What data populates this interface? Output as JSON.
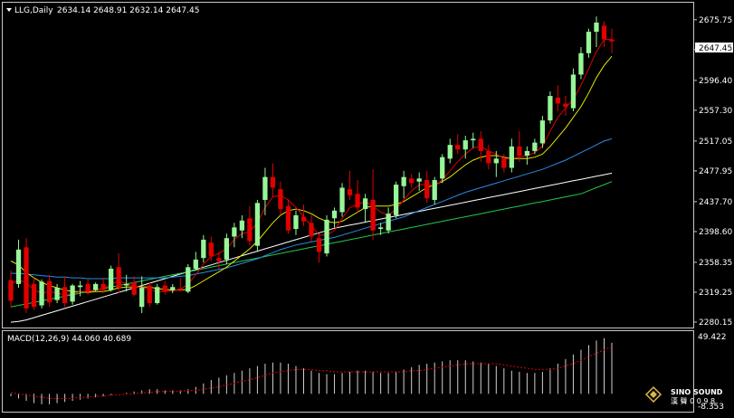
{
  "window": {
    "symbol_timeframe": "LLG,Daily",
    "ohlc_readout": "2634.14 2648.91 2632.14 2647.45",
    "menu_icon": "triangle-down-icon"
  },
  "colors": {
    "background": "#000000",
    "frame": "#c8c8c8",
    "grid_text": "#ffffff",
    "bull_candle": "#98f598",
    "bear_candle": "#e00000",
    "ma_fast": "#e00000",
    "ma_slow": "#e6e600",
    "ma_blue": "#2a8be6",
    "ma_green": "#22c84a",
    "ma_white": "#ffffff",
    "macd_hist": "#cfcfcf",
    "macd_signal": "#e00000",
    "price_tag_bg": "#ffffff",
    "price_tag_text": "#000000"
  },
  "price_axis": {
    "ticks": [
      "2675.75",
      "2636.65",
      "2596.40",
      "2557.30",
      "2517.05",
      "2477.95",
      "2437.70",
      "2398.60",
      "2358.35",
      "2319.25",
      "2280.15"
    ],
    "current_price_label": "2647.45"
  },
  "macd": {
    "label": "MACD(12,26,9) 44.060 40.689",
    "axis_top": "49.422",
    "axis_bottom": "-8.353"
  },
  "watermark": {
    "brand": "SINO SOUND",
    "chinese": "漢 聲 0 0 9 8"
  },
  "chart_data": {
    "type": "candlestick",
    "series_count_visible": 78,
    "ylim": [
      2280.15,
      2680
    ],
    "y_ticks": [
      2675.75,
      2636.65,
      2596.4,
      2557.3,
      2517.05,
      2477.95,
      2437.7,
      2398.6,
      2358.35,
      2319.25,
      2280.15
    ],
    "candles": [
      [
        2335,
        2348,
        2300,
        2308
      ],
      [
        2330,
        2388,
        2325,
        2375
      ],
      [
        2378,
        2390,
        2292,
        2298
      ],
      [
        2330,
        2338,
        2296,
        2300
      ],
      [
        2302,
        2336,
        2298,
        2333
      ],
      [
        2334,
        2342,
        2300,
        2306
      ],
      [
        2309,
        2330,
        2305,
        2325
      ],
      [
        2326,
        2340,
        2300,
        2305
      ],
      [
        2307,
        2330,
        2303,
        2328
      ],
      [
        2326,
        2334,
        2314,
        2328
      ],
      [
        2330,
        2336,
        2316,
        2320
      ],
      [
        2322,
        2332,
        2320,
        2330
      ],
      [
        2330,
        2338,
        2318,
        2322
      ],
      [
        2322,
        2354,
        2320,
        2350
      ],
      [
        2352,
        2370,
        2318,
        2325
      ],
      [
        2328,
        2342,
        2320,
        2330
      ],
      [
        2332,
        2340,
        2314,
        2316
      ],
      [
        2300,
        2340,
        2292,
        2325
      ],
      [
        2328,
        2332,
        2300,
        2305
      ],
      [
        2305,
        2330,
        2303,
        2326
      ],
      [
        2328,
        2334,
        2316,
        2320
      ],
      [
        2322,
        2330,
        2318,
        2326
      ],
      [
        2324,
        2338,
        2320,
        2322
      ],
      [
        2320,
        2356,
        2318,
        2352
      ],
      [
        2350,
        2372,
        2348,
        2362
      ],
      [
        2364,
        2394,
        2358,
        2388
      ],
      [
        2384,
        2392,
        2360,
        2366
      ],
      [
        2364,
        2372,
        2350,
        2360
      ],
      [
        2362,
        2396,
        2356,
        2390
      ],
      [
        2392,
        2410,
        2378,
        2404
      ],
      [
        2400,
        2420,
        2390,
        2413
      ],
      [
        2416,
        2432,
        2380,
        2386
      ],
      [
        2380,
        2440,
        2372,
        2436
      ],
      [
        2440,
        2482,
        2420,
        2470
      ],
      [
        2470,
        2488,
        2444,
        2456
      ],
      [
        2454,
        2464,
        2420,
        2428
      ],
      [
        2432,
        2440,
        2396,
        2400
      ],
      [
        2402,
        2426,
        2394,
        2420
      ],
      [
        2418,
        2434,
        2406,
        2412
      ],
      [
        2410,
        2420,
        2386,
        2392
      ],
      [
        2390,
        2396,
        2358,
        2372
      ],
      [
        2370,
        2420,
        2366,
        2414
      ],
      [
        2416,
        2430,
        2404,
        2426
      ],
      [
        2424,
        2462,
        2418,
        2456
      ],
      [
        2454,
        2478,
        2440,
        2446
      ],
      [
        2448,
        2466,
        2424,
        2430
      ],
      [
        2428,
        2448,
        2410,
        2442
      ],
      [
        2440,
        2480,
        2388,
        2400
      ],
      [
        2402,
        2410,
        2394,
        2404
      ],
      [
        2400,
        2430,
        2396,
        2422
      ],
      [
        2420,
        2464,
        2416,
        2460
      ],
      [
        2458,
        2478,
        2442,
        2470
      ],
      [
        2468,
        2474,
        2456,
        2462
      ],
      [
        2464,
        2476,
        2452,
        2468
      ],
      [
        2466,
        2478,
        2436,
        2442
      ],
      [
        2440,
        2470,
        2434,
        2466
      ],
      [
        2468,
        2500,
        2462,
        2496
      ],
      [
        2494,
        2520,
        2488,
        2512
      ],
      [
        2512,
        2526,
        2500,
        2506
      ],
      [
        2506,
        2524,
        2494,
        2518
      ],
      [
        2518,
        2528,
        2508,
        2520
      ],
      [
        2520,
        2530,
        2490,
        2504
      ],
      [
        2504,
        2512,
        2480,
        2488
      ],
      [
        2488,
        2504,
        2470,
        2494
      ],
      [
        2494,
        2500,
        2476,
        2482
      ],
      [
        2482,
        2520,
        2476,
        2510
      ],
      [
        2510,
        2530,
        2490,
        2498
      ],
      [
        2498,
        2510,
        2486,
        2504
      ],
      [
        2504,
        2520,
        2500,
        2515
      ],
      [
        2514,
        2550,
        2508,
        2544
      ],
      [
        2544,
        2582,
        2540,
        2576
      ],
      [
        2574,
        2590,
        2556,
        2566
      ],
      [
        2566,
        2576,
        2550,
        2562
      ],
      [
        2560,
        2612,
        2556,
        2604
      ],
      [
        2604,
        2640,
        2598,
        2632
      ],
      [
        2632,
        2664,
        2626,
        2660
      ],
      [
        2660,
        2680,
        2640,
        2672
      ],
      [
        2668,
        2674,
        2640,
        2650
      ],
      [
        2650,
        2664,
        2632,
        2647.45
      ]
    ],
    "moving_averages": {
      "ma_fast": [
        2330,
        2335,
        2332,
        2322,
        2318,
        2320,
        2318,
        2316,
        2317,
        2320,
        2320,
        2322,
        2324,
        2330,
        2334,
        2330,
        2327,
        2325,
        2323,
        2320,
        2320,
        2321,
        2323,
        2330,
        2342,
        2356,
        2366,
        2370,
        2376,
        2388,
        2396,
        2398,
        2410,
        2430,
        2444,
        2446,
        2440,
        2430,
        2418,
        2406,
        2394,
        2394,
        2400,
        2416,
        2430,
        2434,
        2438,
        2432,
        2424,
        2420,
        2428,
        2440,
        2452,
        2460,
        2460,
        2458,
        2466,
        2478,
        2490,
        2500,
        2508,
        2510,
        2504,
        2500,
        2494,
        2494,
        2496,
        2498,
        2502,
        2510,
        2530,
        2548,
        2560,
        2572,
        2590,
        2612,
        2634,
        2650,
        2650
      ],
      "ma_slow": [
        2360,
        2355,
        2345,
        2338,
        2332,
        2328,
        2325,
        2322,
        2320,
        2320,
        2319,
        2320,
        2320,
        2322,
        2325,
        2326,
        2326,
        2326,
        2326,
        2324,
        2323,
        2322,
        2322,
        2323,
        2328,
        2334,
        2340,
        2346,
        2352,
        2360,
        2368,
        2376,
        2386,
        2398,
        2410,
        2420,
        2426,
        2428,
        2426,
        2422,
        2416,
        2412,
        2410,
        2412,
        2418,
        2424,
        2430,
        2432,
        2432,
        2432,
        2434,
        2438,
        2444,
        2450,
        2456,
        2460,
        2464,
        2470,
        2478,
        2486,
        2492,
        2496,
        2498,
        2498,
        2496,
        2494,
        2494,
        2494,
        2496,
        2500,
        2510,
        2522,
        2534,
        2548,
        2562,
        2580,
        2600,
        2616,
        2628
      ],
      "ma_blue": [
        2344,
        2344,
        2343,
        2342,
        2341,
        2340,
        2339,
        2339,
        2338,
        2338,
        2337,
        2337,
        2337,
        2337,
        2338,
        2338,
        2338,
        2338,
        2338,
        2338,
        2338,
        2339,
        2340,
        2341,
        2343,
        2345,
        2347,
        2349,
        2351,
        2354,
        2357,
        2360,
        2363,
        2367,
        2371,
        2375,
        2378,
        2381,
        2383,
        2385,
        2387,
        2389,
        2391,
        2394,
        2397,
        2400,
        2403,
        2406,
        2409,
        2412,
        2415,
        2418,
        2422,
        2426,
        2430,
        2434,
        2438,
        2442,
        2446,
        2450,
        2453,
        2456,
        2459,
        2462,
        2465,
        2468,
        2471,
        2474,
        2477,
        2480,
        2484,
        2488,
        2492,
        2497,
        2502,
        2507,
        2512,
        2517,
        2520
      ],
      "ma_green": [
        2300,
        2302,
        2304,
        2306,
        2308,
        2310,
        2312,
        2314,
        2316,
        2318,
        2320,
        2322,
        2324,
        2326,
        2328,
        2330,
        2332,
        2334,
        2336,
        2338,
        2340,
        2342,
        2344,
        2346,
        2348,
        2350,
        2352,
        2354,
        2356,
        2358,
        2360,
        2362,
        2364,
        2366,
        2368,
        2370,
        2372,
        2374,
        2376,
        2378,
        2380,
        2382,
        2384,
        2386,
        2388,
        2390,
        2392,
        2394,
        2396,
        2398,
        2400,
        2402,
        2404,
        2406,
        2408,
        2410,
        2412,
        2414,
        2416,
        2418,
        2420,
        2422,
        2424,
        2426,
        2428,
        2430,
        2432,
        2434,
        2436,
        2438,
        2440,
        2442,
        2444,
        2446,
        2448,
        2452,
        2456,
        2460,
        2464
      ],
      "ma_white": [
        2280,
        2281,
        2283,
        2286,
        2289,
        2292,
        2295,
        2298,
        2301,
        2304,
        2307,
        2310,
        2313,
        2316,
        2319,
        2322,
        2325,
        2328,
        2331,
        2334,
        2337,
        2340,
        2343,
        2346,
        2349,
        2352,
        2355,
        2358,
        2361,
        2364,
        2367,
        2370,
        2373,
        2376,
        2379,
        2382,
        2385,
        2388,
        2391,
        2394,
        2397,
        2400,
        2403,
        2405,
        2407,
        2409,
        2411,
        2413,
        2415,
        2417,
        2419,
        2421,
        2423,
        2425,
        2427,
        2429,
        2431,
        2433,
        2435,
        2437,
        2439,
        2441,
        2443,
        2445,
        2447,
        2449,
        2451,
        2453,
        2455,
        2457,
        2459,
        2461,
        2463,
        2465,
        2467,
        2469,
        2471,
        2473,
        2475
      ]
    },
    "macd_hist": [
      -2,
      -4,
      -6,
      -8,
      -9,
      -9,
      -8,
      -7,
      -6,
      -5,
      -4,
      -3,
      -2,
      -1,
      0,
      1,
      2,
      3,
      4,
      4,
      3,
      3,
      3,
      4,
      6,
      9,
      12,
      14,
      16,
      18,
      20,
      22,
      24,
      26,
      27,
      27,
      26,
      24,
      22,
      20,
      18,
      17,
      17,
      18,
      19,
      20,
      20,
      19,
      18,
      18,
      19,
      21,
      23,
      25,
      26,
      27,
      28,
      29,
      29,
      29,
      28,
      27,
      26,
      24,
      22,
      20,
      19,
      18,
      18,
      19,
      22,
      26,
      30,
      34,
      38,
      42,
      46,
      48,
      44.06
    ],
    "macd_signal": [
      1,
      0,
      -1,
      -2,
      -3,
      -4,
      -4,
      -4,
      -4,
      -3,
      -3,
      -2,
      -2,
      -1,
      -1,
      0,
      0,
      1,
      1,
      2,
      2,
      2,
      2,
      3,
      3,
      4,
      5,
      6,
      8,
      9,
      11,
      12,
      14,
      16,
      18,
      19,
      20,
      21,
      21,
      21,
      20,
      20,
      19,
      19,
      19,
      19,
      19,
      19,
      19,
      19,
      19,
      19,
      20,
      20,
      21,
      22,
      23,
      24,
      25,
      26,
      26,
      26,
      26,
      26,
      25,
      24,
      23,
      22,
      21,
      21,
      21,
      22,
      24,
      26,
      29,
      32,
      35,
      38,
      40.689
    ],
    "macd_ylim": [
      -8.353,
      49.422
    ]
  }
}
